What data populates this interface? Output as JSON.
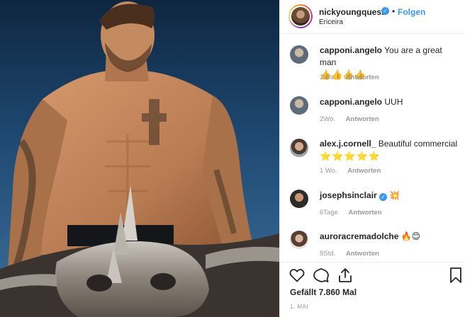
{
  "post": {
    "username": "nickyoungquest",
    "location": "Ericeira",
    "follow_label": "Folgen",
    "separator": "•"
  },
  "comments": [
    {
      "username": "capponi.angelo",
      "text": "You are a great man",
      "emoji": "👍👍👍👍",
      "time": "2Wo.",
      "reply": "Antworten"
    },
    {
      "username": "capponi.angelo",
      "text": "UUH",
      "emoji": "",
      "time": "2Wo.",
      "reply": "Antworten"
    },
    {
      "username": "alex.j.cornell_",
      "text": "Beautiful commercial",
      "emoji": "⭐⭐⭐⭐⭐",
      "time": "1 Wo.",
      "reply": "Antworten"
    },
    {
      "username": "josephsinclair",
      "text": "",
      "emoji": "💥",
      "time": "6Tage",
      "reply": "Antworten"
    },
    {
      "username": "auroracremadolche",
      "text": "",
      "emoji": "🔥😊",
      "time": "8Std.",
      "reply": "Antworten"
    }
  ],
  "footer": {
    "likes": "Gefällt 7.860 Mal",
    "date": "1. MAI"
  },
  "icons": [
    "heart-icon",
    "comment-icon",
    "share-icon",
    "bookmark-icon",
    "verified-icon"
  ],
  "colors": {
    "accent": "#3897f0",
    "text": "#262626",
    "muted": "#999999"
  }
}
